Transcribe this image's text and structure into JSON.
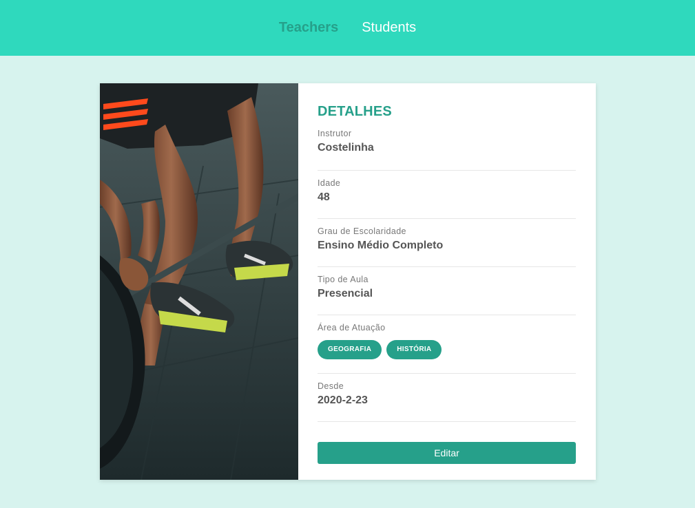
{
  "nav": {
    "items": [
      {
        "label": "Teachers",
        "active": true
      },
      {
        "label": "Students",
        "active": false
      }
    ]
  },
  "card": {
    "image": "weightlifting-deadlift-photo",
    "heading": "DETALHES",
    "fields": [
      {
        "label": "Instrutor",
        "value": "Costelinha"
      },
      {
        "label": "Idade",
        "value": "48"
      },
      {
        "label": "Grau de Escolaridade",
        "value": "Ensino Médio Completo"
      },
      {
        "label": "Tipo de Aula",
        "value": "Presencial"
      }
    ],
    "area": {
      "label": "Área de Atuação",
      "tags": [
        "GEOGRAFIA",
        "HISTÓRIA"
      ]
    },
    "since": {
      "label": "Desde",
      "value": "2020-2-23"
    },
    "edit_label": "Editar"
  },
  "colors": {
    "header": "#2fd9bd",
    "background": "#d7f3ee",
    "accent": "#26a08a"
  }
}
